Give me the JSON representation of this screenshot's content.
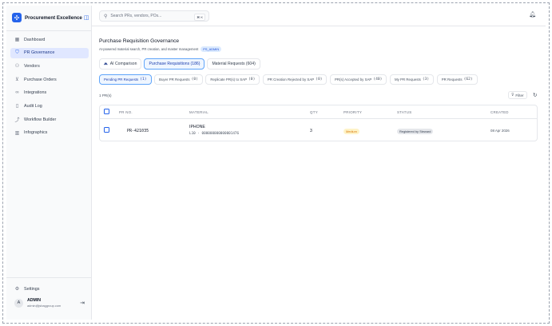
{
  "brand": {
    "name": "Procurement Excellence"
  },
  "sidebar": {
    "items": [
      {
        "label": "Dashboard",
        "icon": "grid-icon"
      },
      {
        "label": "PR Governance",
        "icon": "shield-icon",
        "active": true
      },
      {
        "label": "Vendors",
        "icon": "users-icon"
      },
      {
        "label": "Purchase Orders",
        "icon": "cart-icon"
      },
      {
        "label": "Integrations",
        "icon": "link-icon"
      },
      {
        "label": "Audit Log",
        "icon": "clipboard-icon"
      },
      {
        "label": "Workflow Builder",
        "icon": "workflow-icon"
      },
      {
        "label": "Infographics",
        "icon": "chart-icon"
      }
    ],
    "settings_label": "Settings",
    "user": {
      "initial": "A",
      "name": "ADMIN",
      "email": "admin@jsbaggroup.com"
    }
  },
  "search": {
    "placeholder": "Search PRs, vendors, POs...",
    "shortcut": "⌘ K"
  },
  "page": {
    "title": "Purchase Requisition Governance",
    "subtitle": "AI-powered material search, PR creation, and master management",
    "role_badge": "PS_ADMIN"
  },
  "tabs": [
    {
      "label": "AI Comparison",
      "icon": "ai-icon"
    },
    {
      "label": "Purchase Requisitions (186)",
      "active": true
    },
    {
      "label": "Material Requests (604)"
    }
  ],
  "subtabs": [
    {
      "label": "Pending PR Requests",
      "count": "(1)",
      "active": true
    },
    {
      "label": "Buyer PR Requests",
      "count": "(0)"
    },
    {
      "label": "Replicate PR(s) to SAP",
      "count": "(0)"
    },
    {
      "label": "PR Creation Rejected by SAP",
      "count": "(0)"
    },
    {
      "label": "PR(s) Accepted by SAP",
      "count": "(40)"
    },
    {
      "label": "My PR Requests",
      "count": "(3)"
    },
    {
      "label": "PR Requests",
      "count": "(62)"
    }
  ],
  "results": {
    "count_label": "1 PR(s)",
    "filter_label": "Filter"
  },
  "table": {
    "columns": [
      "PR NO.",
      "MATERIAL",
      "QTY",
      "PRIORITY",
      "STATUS",
      "CREATED"
    ],
    "rows": [
      {
        "pr_no": "PR-421035",
        "material": "IPHONE",
        "material_code": "L10 · 000000000000001476",
        "qty": "3",
        "priority": "Medium",
        "status": "Registered by Steward",
        "created": "08 Apr 2026"
      }
    ]
  },
  "colors": {
    "accent": "#2563eb",
    "active_bg": "#e0e7ff",
    "medium": "#d97706"
  }
}
